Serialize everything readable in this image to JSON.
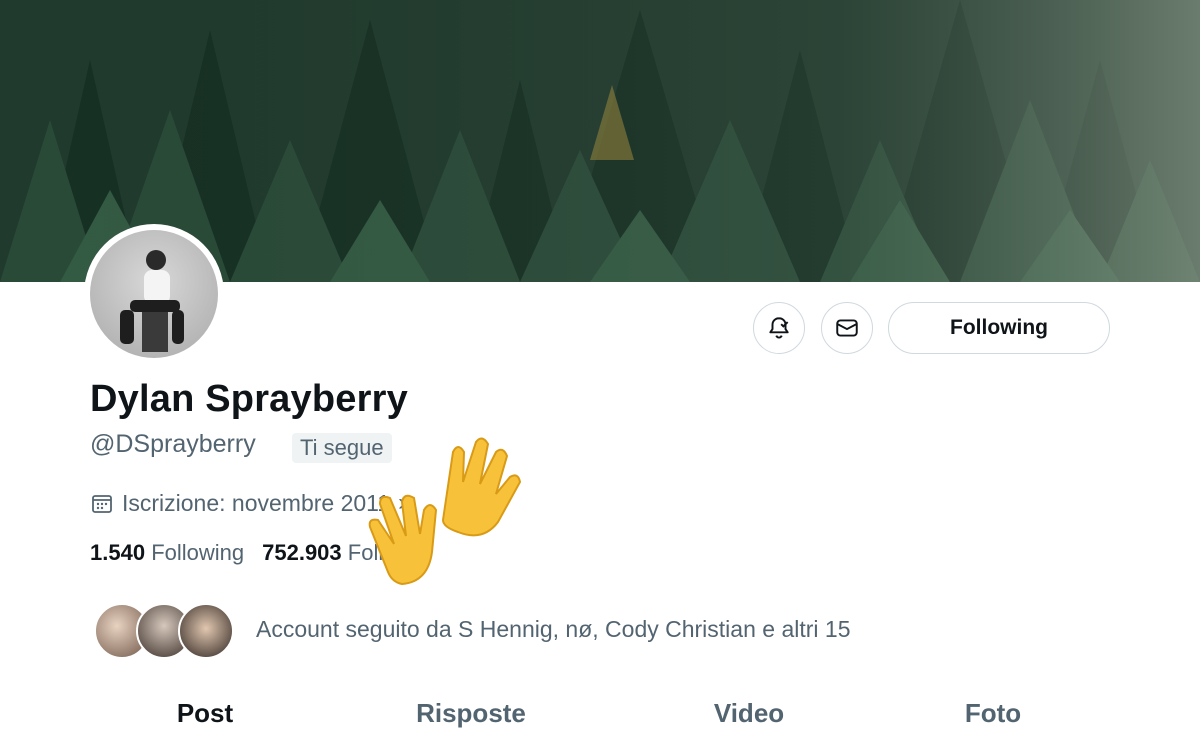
{
  "profile": {
    "name": "Dylan Sprayberry",
    "handle": "@DSprayberry",
    "follows_you_badge": "Ti segue",
    "joined": "Iscrizione: novembre 2011",
    "following_count": "1.540",
    "following_label": "Following",
    "followers_count": "752.903",
    "followers_label": "Follower",
    "followed_by": "Account seguito da S Hennig, nø, Cody Christian e altri 15"
  },
  "actions": {
    "notify_icon": "bell-check-icon",
    "message_icon": "envelope-icon",
    "follow_label": "Following"
  },
  "tabs": [
    {
      "label": "Post",
      "active": true
    },
    {
      "label": "Risposte",
      "active": false
    },
    {
      "label": "Video",
      "active": false
    },
    {
      "label": "Foto",
      "active": false
    }
  ],
  "colors": {
    "text_primary": "#0f1419",
    "text_secondary": "#536471",
    "border": "#cfd9de",
    "banner": "#233c30"
  },
  "overlay": {
    "icon": "waving-hands-emoji"
  }
}
